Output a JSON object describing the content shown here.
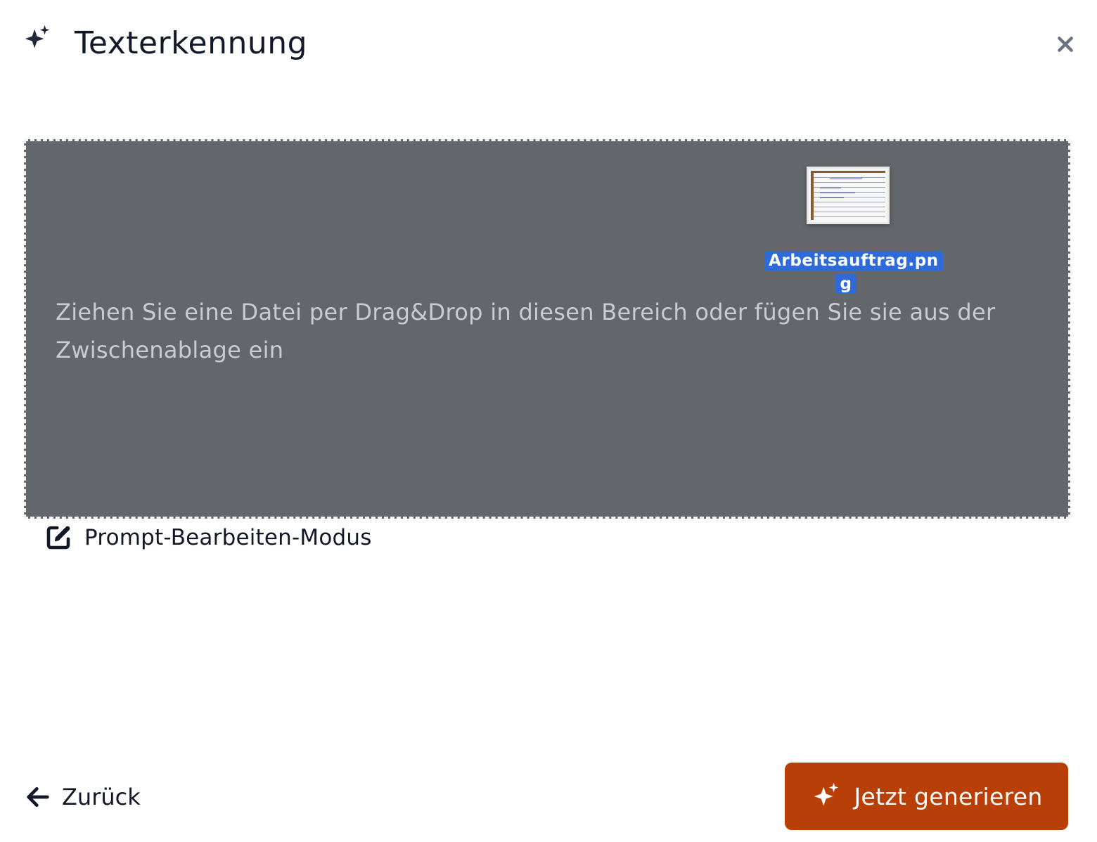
{
  "dialog": {
    "title": "Texterkennung",
    "icons": {
      "title": "sparkles-icon",
      "close": "close-icon"
    }
  },
  "dropzone": {
    "instruction": "Ziehen Sie eine Datei per Drag&Drop in diesen Bereich oder fügen Sie sie aus der Zwischenablage ein",
    "dragged_file": {
      "name_line1": "Arbeitsauftrag.pn",
      "name_line2": "g"
    }
  },
  "prompt_mode": {
    "label": "Prompt-Bearbeiten-Modus",
    "icon": "edit-icon"
  },
  "footer": {
    "back_label": "Zurück",
    "back_icon": "arrow-left-icon",
    "generate_label": "Jetzt generieren",
    "generate_icon": "sparkles-icon"
  },
  "colors": {
    "dropzone_bg": "#63666b",
    "generate_button": "#b83f07",
    "file_label_highlight": "#2f6bd8"
  }
}
